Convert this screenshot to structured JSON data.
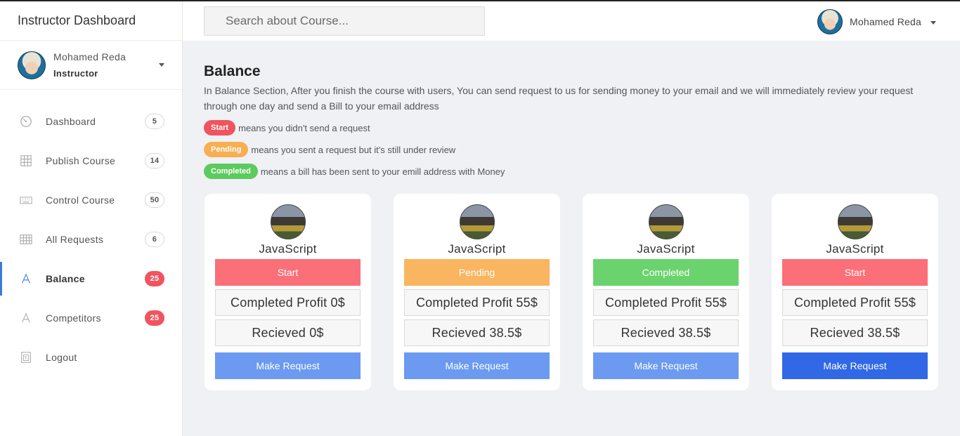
{
  "sidebar": {
    "title": "Instructor Dashboard",
    "user": {
      "name": "Mohamed Reda",
      "role": "Instructor"
    },
    "items": [
      {
        "label": "Dashboard",
        "count": "5",
        "icon": "gauge-icon",
        "badge_style": "plain"
      },
      {
        "label": "Publish Course",
        "count": "14",
        "icon": "grid-icon",
        "badge_style": "plain"
      },
      {
        "label": "Control Course",
        "count": "50",
        "icon": "keyboard-icon",
        "badge_style": "plain"
      },
      {
        "label": "All Requests",
        "count": "6",
        "icon": "table-icon",
        "badge_style": "plain"
      },
      {
        "label": "Balance",
        "count": "25",
        "icon": "letter-a-icon",
        "badge_style": "red",
        "active": true
      },
      {
        "label": "Competitors",
        "count": "25",
        "icon": "letter-a-icon",
        "badge_style": "red"
      },
      {
        "label": "Logout",
        "icon": "logout-icon"
      }
    ]
  },
  "topbar": {
    "search_placeholder": "Search about Course...",
    "user_name": "Mohamed Reda"
  },
  "main": {
    "title": "Balance",
    "description": "In Balance Section, After you finish the course with users, You can send request to us for sending money to your email and we will immediately review your request through one day and send a Bill to your email address",
    "legend": [
      {
        "pill": "Start",
        "text": "means you didn't send a request"
      },
      {
        "pill": "Pending",
        "text": "means you sent a request but it's still under review"
      },
      {
        "pill": "Completed",
        "text": "means a bill has been sent to your emill address with Money"
      }
    ]
  },
  "cards": [
    {
      "course": "JavaScript",
      "status": "Start",
      "profit": "Completed Profit 0$",
      "received": "Recieved 0$",
      "button": "Make Request"
    },
    {
      "course": "JavaScript",
      "status": "Pending",
      "profit": "Completed Profit 55$",
      "received": "Recieved 38.5$",
      "button": "Make Request"
    },
    {
      "course": "JavaScript",
      "status": "Completed",
      "profit": "Completed Profit 55$",
      "received": "Recieved 38.5$",
      "button": "Make Request"
    },
    {
      "course": "JavaScript",
      "status": "Start",
      "profit": "Completed Profit 55$",
      "received": "Recieved 38.5$",
      "button": "Make Request"
    }
  ],
  "colors": {
    "start": "#fb6f78",
    "pending": "#f9b560",
    "completed": "#6ad36e",
    "button": "#6b9af0",
    "button_strong": "#3068e6",
    "badge_red": "#f0545e",
    "active_indicator": "#3b7bdc"
  }
}
